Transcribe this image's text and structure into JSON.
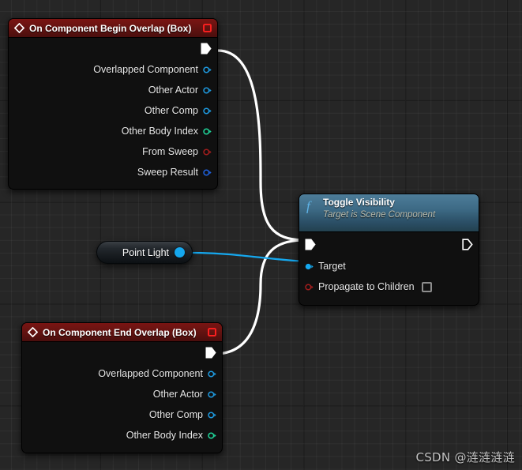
{
  "graph": {
    "background_color": "#262626",
    "grid_minor_color": "#2f2f2f",
    "grid_major_color": "#151515"
  },
  "nodes": {
    "begin_overlap": {
      "title": "On Component Begin Overlap (Box)",
      "header_color": "#651311",
      "icon": "event-diamond-icon",
      "delegate_icon": "delegate-pin-icon",
      "exec_out_label": "",
      "outputs": [
        {
          "label": "Overlapped Component",
          "pin_color": "#1e9ae0",
          "pin_type": "object"
        },
        {
          "label": "Other Actor",
          "pin_color": "#1e9ae0",
          "pin_type": "object"
        },
        {
          "label": "Other Comp",
          "pin_color": "#1e9ae0",
          "pin_type": "object"
        },
        {
          "label": "Other Body Index",
          "pin_color": "#1fd69a",
          "pin_type": "int"
        },
        {
          "label": "From Sweep",
          "pin_color": "#a11d1d",
          "pin_type": "bool"
        },
        {
          "label": "Sweep Result",
          "pin_color": "#1f62e0",
          "pin_type": "struct"
        }
      ]
    },
    "end_overlap": {
      "title": "On Component End Overlap (Box)",
      "header_color": "#651311",
      "icon": "event-diamond-icon",
      "delegate_icon": "delegate-pin-icon",
      "outputs": [
        {
          "label": "Overlapped Component",
          "pin_color": "#1e9ae0",
          "pin_type": "object"
        },
        {
          "label": "Other Actor",
          "pin_color": "#1e9ae0",
          "pin_type": "object"
        },
        {
          "label": "Other Comp",
          "pin_color": "#1e9ae0",
          "pin_type": "object"
        },
        {
          "label": "Other Body Index",
          "pin_color": "#1fd69a",
          "pin_type": "int"
        }
      ]
    },
    "toggle_visibility": {
      "title": "Toggle Visibility",
      "subtitle": "Target is Scene Component",
      "header_color": "#3d6a85",
      "icon": "function-f-icon",
      "inputs": [
        {
          "label": "Target",
          "pin_color": "#15a8ef",
          "pin_type": "object",
          "filled": true
        },
        {
          "label": "Propagate to Children",
          "pin_color": "#a11d1d",
          "pin_type": "bool",
          "filled": false,
          "checkbox": true,
          "checked": false
        }
      ]
    },
    "point_light": {
      "label": "Point Light",
      "pin_color": "#15a8ef"
    }
  },
  "wires": [
    {
      "from": "begin_overlap.exec",
      "to": "toggle_visibility.exec_in",
      "color": "#ffffff",
      "type": "exec"
    },
    {
      "from": "end_overlap.exec",
      "to": "toggle_visibility.exec_in",
      "color": "#ffffff",
      "type": "exec"
    },
    {
      "from": "point_light.out",
      "to": "toggle_visibility.target",
      "color": "#15a8ef",
      "type": "data"
    }
  ],
  "watermark": {
    "text": "CSDN @涟涟涟涟"
  }
}
